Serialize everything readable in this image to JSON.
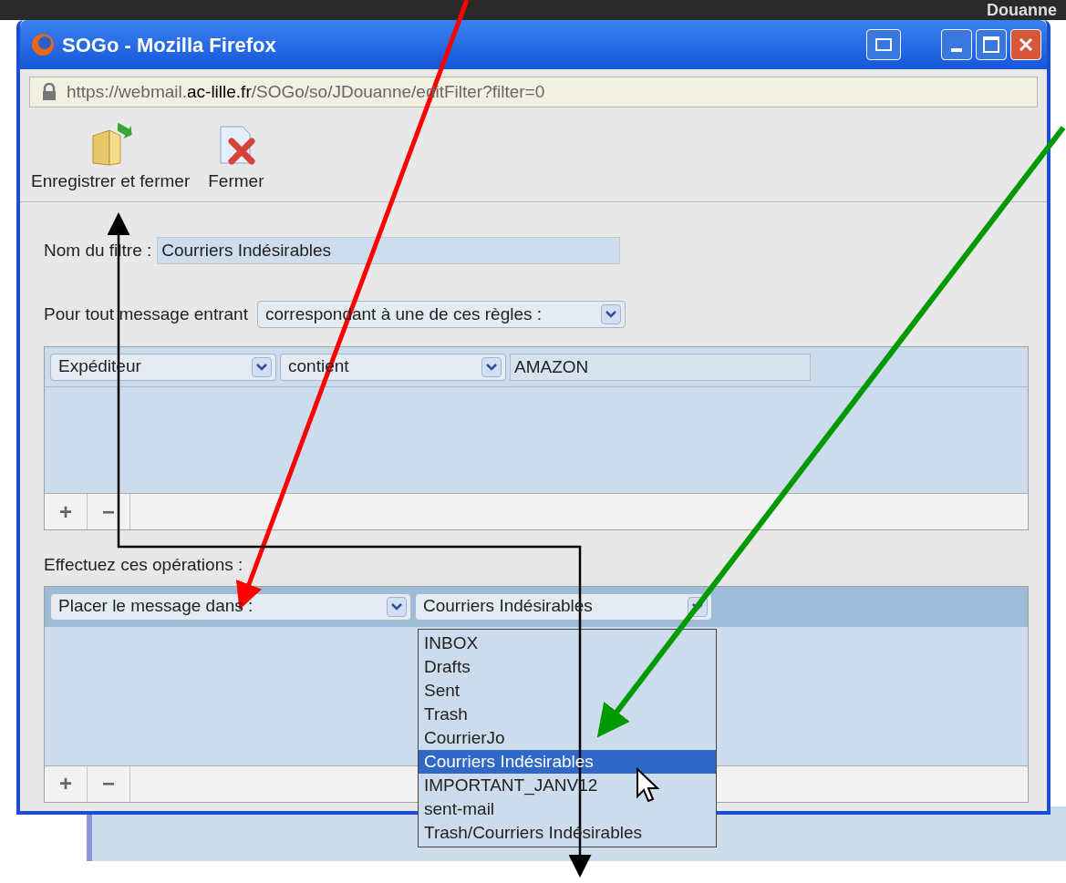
{
  "background": {
    "title_fragment": "Douanne"
  },
  "window": {
    "title": "SOGo - Mozilla Firefox",
    "url_parts": [
      {
        "text": "https://webmail.",
        "emphasis": false
      },
      {
        "text": "ac-lille.fr",
        "emphasis": true
      },
      {
        "text": "/SOGo/so/JDouanne/editFilter?filter=0",
        "emphasis": false
      }
    ]
  },
  "toolbar": {
    "buttons": [
      {
        "label": "Enregistrer et fermer",
        "kind": "save"
      },
      {
        "label": "Fermer",
        "kind": "close"
      }
    ]
  },
  "filter_name": {
    "label": "Nom du filtre :",
    "value": "Courriers Indésirables"
  },
  "match": {
    "label": "Pour tout message entrant",
    "value": "correspondant à une de ces règles :"
  },
  "rules": [
    {
      "field": "Expéditeur",
      "operator": "contient",
      "value": "AMAZON"
    }
  ],
  "rules_buttons": [
    "+",
    "−"
  ],
  "actions_label": "Effectuez ces opérations :",
  "actions": [
    {
      "action": "Placer le message dans :",
      "target": "Courriers Indésirables",
      "selected": true
    }
  ],
  "actions_buttons": [
    "+",
    "−"
  ],
  "folder_menu": {
    "options": [
      {
        "label": "INBOX",
        "selected": false
      },
      {
        "label": "Drafts",
        "selected": false
      },
      {
        "label": "Sent",
        "selected": false
      },
      {
        "label": "Trash",
        "selected": false
      },
      {
        "label": "CourrierJo",
        "selected": false
      },
      {
        "label": "Courriers Indésirables",
        "selected": true
      },
      {
        "label": "IMPORTANT_JANV12",
        "selected": false
      },
      {
        "label": "sent-mail",
        "selected": false
      },
      {
        "label": "Trash/Courriers Indésirables",
        "selected": false
      }
    ]
  }
}
